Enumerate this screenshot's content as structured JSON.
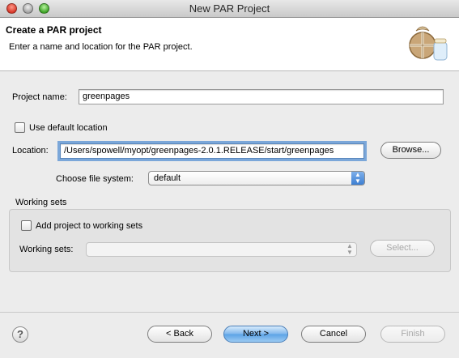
{
  "window": {
    "title": "New PAR Project"
  },
  "banner": {
    "title": "Create a PAR project",
    "description": "Enter a name and location for the PAR project."
  },
  "form": {
    "project_name_label": "Project name:",
    "project_name_value": "greenpages",
    "use_default_location_label": "Use default location",
    "use_default_location_checked": false,
    "location_label": "Location:",
    "location_value": "/Users/spowell/myopt/greenpages-2.0.1.RELEASE/start/greenpages",
    "browse_label": "Browse...",
    "file_system_label": "Choose file system:",
    "file_system_value": "default"
  },
  "working_sets": {
    "group_label": "Working sets",
    "add_label": "Add project to working sets",
    "add_checked": false,
    "sets_label": "Working sets:",
    "sets_value": "",
    "select_label": "Select..."
  },
  "footer": {
    "back_label": "< Back",
    "next_label": "Next >",
    "cancel_label": "Cancel",
    "finish_label": "Finish",
    "help_glyph": "?"
  },
  "icons": {
    "banner": "par-project-wizard-icon",
    "help": "help-icon"
  },
  "colors": {
    "default_button": "#5aa2e6",
    "focus_ring": "#7ba7d9",
    "window_bg": "#ececec"
  }
}
